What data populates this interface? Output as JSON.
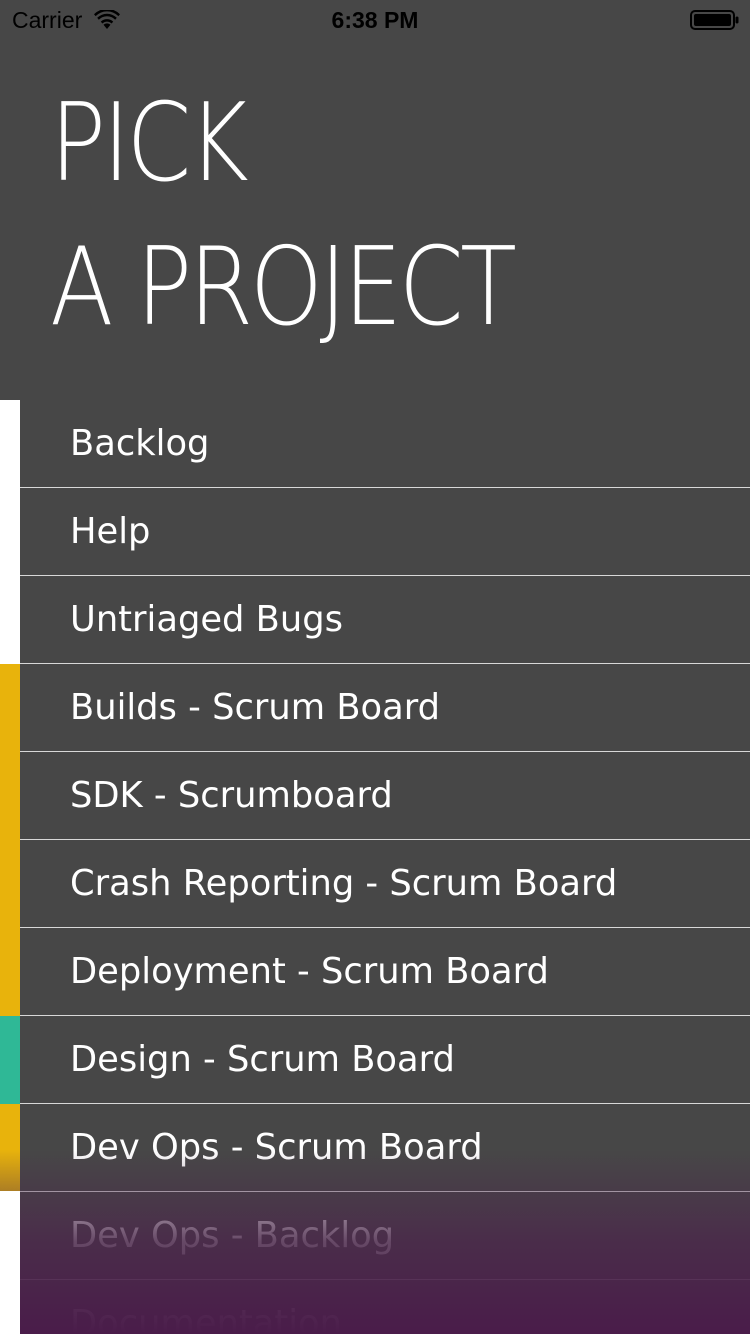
{
  "status_bar": {
    "carrier": "Carrier",
    "time": "6:38 PM",
    "wifi_icon": "wifi-icon",
    "battery_icon": "battery-icon"
  },
  "header": {
    "line1": "PICK",
    "line2": "A PROJECT"
  },
  "colors": {
    "background": "#474747",
    "stripe_white": "#ffffff",
    "stripe_yellow": "#e8b30c",
    "stripe_teal": "#2fb896",
    "bottom_tint": "#4a1c4a"
  },
  "projects": [
    {
      "label": "Backlog",
      "stripe": "white"
    },
    {
      "label": "Help",
      "stripe": "white"
    },
    {
      "label": "Untriaged Bugs",
      "stripe": "white"
    },
    {
      "label": "Builds - Scrum Board",
      "stripe": "yellow"
    },
    {
      "label": "SDK - Scrumboard",
      "stripe": "yellow"
    },
    {
      "label": "Crash Reporting - Scrum Board",
      "stripe": "yellow"
    },
    {
      "label": "Deployment - Scrum Board",
      "stripe": "yellow"
    },
    {
      "label": "Design - Scrum Board",
      "stripe": "teal"
    },
    {
      "label": "Dev Ops - Scrum Board",
      "stripe": "yellow"
    },
    {
      "label": "Dev Ops - Backlog",
      "stripe": "white"
    },
    {
      "label": "Documentation",
      "stripe": "white"
    }
  ]
}
